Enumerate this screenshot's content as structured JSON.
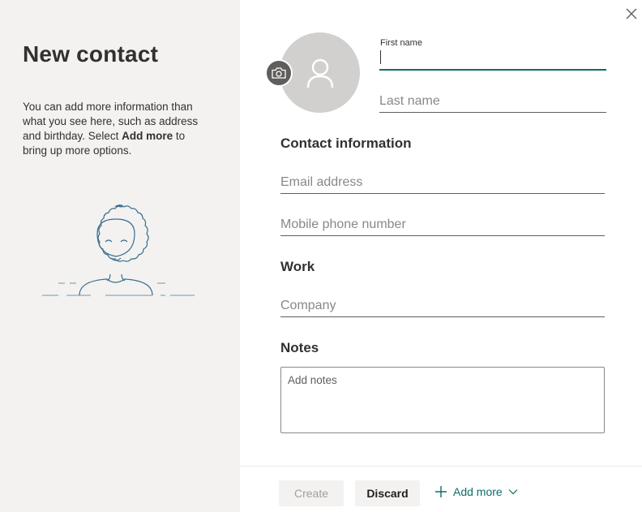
{
  "sidebar": {
    "title": "New contact",
    "description_parts": [
      "You can add more information than what you see here, such as address and birthday. Select ",
      "Add more",
      " to bring up more options."
    ]
  },
  "form": {
    "first_name_label": "First name",
    "first_name_value": "",
    "last_name_placeholder": "Last name",
    "contact_heading": "Contact information",
    "email_placeholder": "Email address",
    "mobile_placeholder": "Mobile phone number",
    "work_heading": "Work",
    "company_placeholder": "Company",
    "notes_heading": "Notes",
    "notes_placeholder": "Add notes"
  },
  "footer": {
    "create_label": "Create",
    "discard_label": "Discard",
    "add_more_label": "Add more"
  },
  "icons": {
    "close": "close-icon",
    "camera": "camera-icon",
    "person": "person-icon",
    "add": "plus-icon",
    "chevron": "chevron-down-icon"
  },
  "colors": {
    "accent": "#0f6d66",
    "left_pane_bg": "#f3f2f1",
    "avatar_bg": "#d2d0ce",
    "camera_bg": "#605e5c"
  }
}
